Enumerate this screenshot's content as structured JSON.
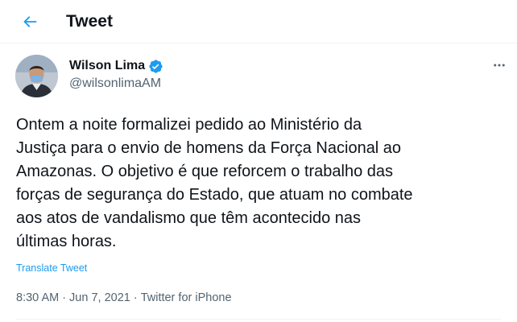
{
  "header": {
    "title": "Tweet"
  },
  "author": {
    "name": "Wilson Lima",
    "handle": "@wilsonlimaAM",
    "verified": true
  },
  "tweet": {
    "text": "Ontem a noite formalizei pedido ao Ministério da\nJustiça para o envio de homens da Força Nacional ao\nAmazonas. O objetivo é que reforcem o trabalho das\nforças de segurança do Estado, que atuam no combate\naos atos de vandalismo que têm acontecido nas\núltimas horas.",
    "translate_label": "Translate Tweet",
    "time": "8:30 AM",
    "date": "Jun 7, 2021",
    "source": "Twitter for iPhone",
    "separator": "·"
  },
  "colors": {
    "accent": "#1d9bf0",
    "text": "#0f1419",
    "secondary": "#536471"
  },
  "icons": {
    "back": "arrow-left-icon",
    "verified": "verified-badge-icon",
    "more": "more-horizontal-icon"
  }
}
